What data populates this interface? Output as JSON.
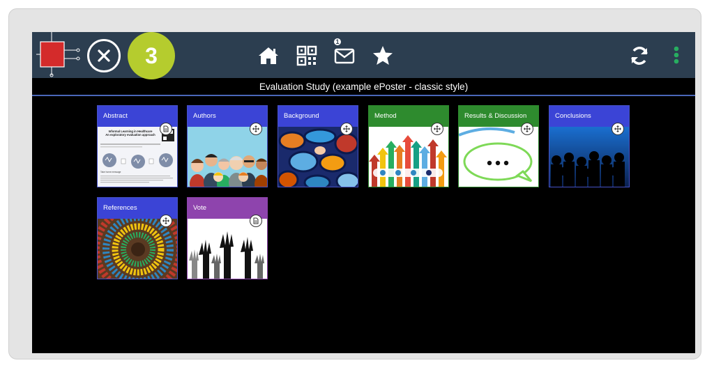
{
  "header": {
    "step_number": "3",
    "notifications_count": "1",
    "logo_color": "#d42b2b",
    "badge_color": "#b5cc2e",
    "bar_color": "#2c3e50"
  },
  "nav": {
    "icons": [
      "home-icon",
      "qr-code-icon",
      "envelope-icon",
      "star-icon"
    ],
    "right_icons": [
      "sync-icon",
      "kebab-menu-icon"
    ]
  },
  "page_title": "Evaluation Study (example ePoster - classic style)",
  "tiles": [
    {
      "label": "Abstract",
      "color": "#3b44d6",
      "badge": "document-icon"
    },
    {
      "label": "Authors",
      "color": "#3b44d6",
      "badge": "move-icon"
    },
    {
      "label": "Background",
      "color": "#3b44d6",
      "badge": "move-icon"
    },
    {
      "label": "Method",
      "color": "#2e8b2e",
      "badge": "move-icon"
    },
    {
      "label": "Results & Discussion",
      "color": "#2e8b2e",
      "badge": "move-icon"
    },
    {
      "label": "Conclusions",
      "color": "#3b44d6",
      "badge": "move-icon"
    },
    {
      "label": "References",
      "color": "#3b44d6",
      "badge": "move-icon"
    },
    {
      "label": "Vote",
      "color": "#8e44ad",
      "badge": "document-icon"
    }
  ],
  "abstract_preview": {
    "title": "Informal Learning in Healthcare",
    "subtitle": "An exploratory evaluation approach",
    "section": "Take home message"
  }
}
